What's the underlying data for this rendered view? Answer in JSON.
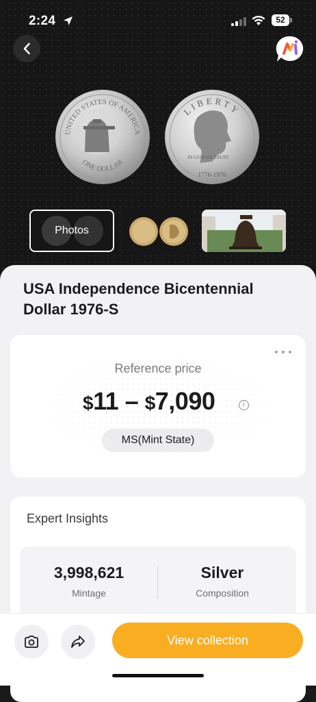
{
  "status_bar": {
    "time": "2:24",
    "battery": "52"
  },
  "gallery": {
    "photos_label": "Photos"
  },
  "coin": {
    "title": "USA Independence Bicentennial Dollar 1976-S",
    "obverse_text": "UNITED STATES OF AMERICA",
    "obverse_bottom": "ONE DOLLAR",
    "reverse_text": "LIBERTY",
    "reverse_motto": "IN GOD WE TRUST",
    "reverse_date": "1776-1976"
  },
  "price_card": {
    "label": "Reference price",
    "price_low": "11",
    "price_high": "7,090",
    "currency": "$",
    "dash": "–",
    "grade": "MS(Mint State)"
  },
  "insights": {
    "title": "Expert Insights",
    "stats": [
      {
        "value": "3,998,621",
        "label": "Mintage"
      },
      {
        "value": "Silver",
        "label": "Composition"
      }
    ]
  },
  "bottom_bar": {
    "cta_label": "View collection"
  },
  "colors": {
    "accent": "#f9ae22",
    "hero_bg": "#161616",
    "sheet_bg": "#f2f2f4"
  },
  "icons": [
    "location-arrow-icon",
    "signal-icon",
    "wifi-icon",
    "battery-icon",
    "back-chevron-icon",
    "app-logo-icon",
    "more-dots-icon",
    "info-icon",
    "camera-icon",
    "share-icon"
  ]
}
